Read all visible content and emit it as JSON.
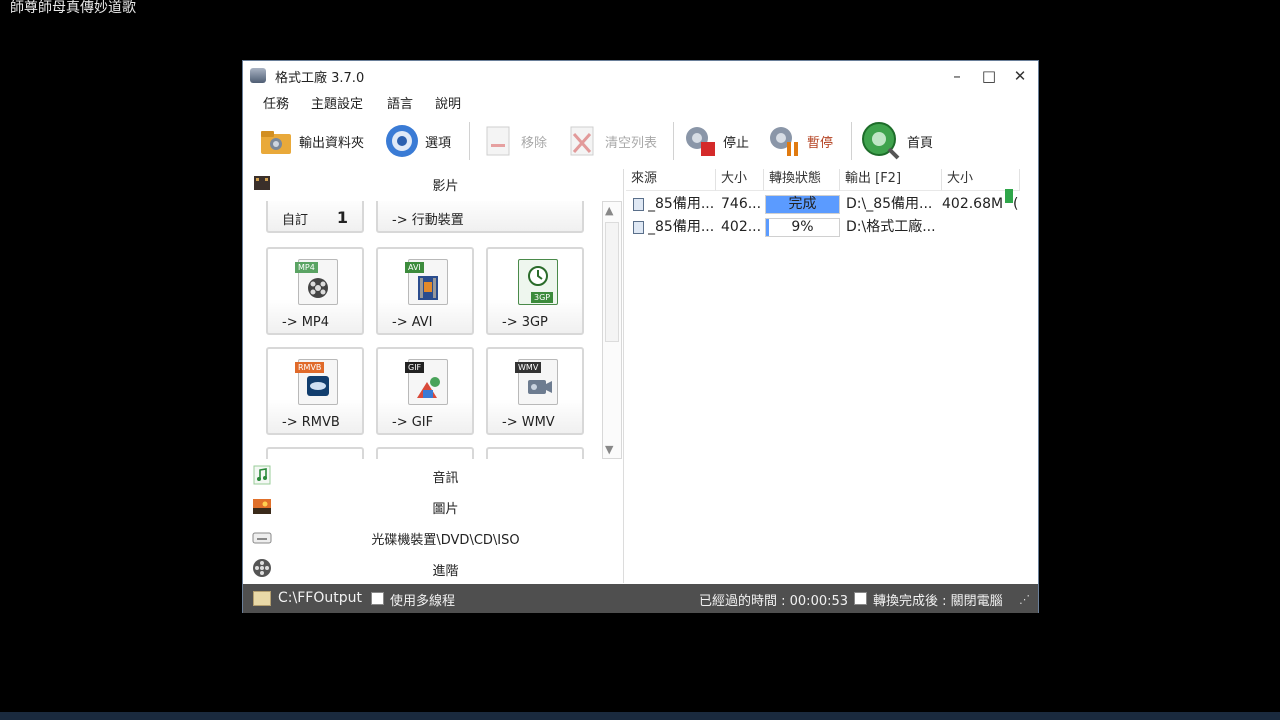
{
  "desktop": {
    "title": "師尊師母真傳妙道歌"
  },
  "window": {
    "title": "格式工廠 3.7.0",
    "controls": {
      "minimize": "–",
      "maximize": "□",
      "close": "✕"
    }
  },
  "menu": [
    "任務",
    "主題設定",
    "語言",
    "說明"
  ],
  "toolbar": {
    "output_folder": "輸出資料夾",
    "options": "選項",
    "remove": "移除",
    "clear_list": "清空列表",
    "stop": "停止",
    "pause": "暫停",
    "home": "首頁"
  },
  "categories": {
    "video": "影片",
    "audio": "音訊",
    "image": "圖片",
    "disc": "光碟機裝置\\DVD\\CD\\ISO",
    "advanced": "進階"
  },
  "tiles": {
    "custom": "自訂",
    "custom_badge": "1",
    "mobile": "-> 行動裝置",
    "mp4": "-> MP4",
    "avi": "-> AVI",
    "3gp": "-> 3GP",
    "rmvb": "-> RMVB",
    "gif": "-> GIF",
    "wmv": "-> WMV"
  },
  "file_tags": {
    "mp4": "MP4",
    "avi": "AVI",
    "3gp": "3GP",
    "rmvb": "RMVB",
    "gif": "GIF",
    "wmv": "WMV"
  },
  "table": {
    "headers": [
      "來源",
      "大小",
      "轉換狀態",
      "輸出 [F2]",
      "大小"
    ],
    "rows": [
      {
        "source": "_85備用...",
        "size": "746...",
        "status": "完成",
        "progress": 1.0,
        "output": "D:\\_85備用...",
        "out_size": "402.68M",
        "out_extra": "("
      },
      {
        "source": "_85備用...",
        "size": "402...",
        "status": "9%",
        "progress": 0.09,
        "output": "D:\\格式工廠...",
        "out_size": "",
        "out_extra": ""
      }
    ]
  },
  "statusbar": {
    "output_path": "C:\\FFOutput",
    "multithread": "使用多線程",
    "elapsed": "已經過的時間 : 00:00:53",
    "after_convert": "轉換完成後 : 關閉電腦"
  },
  "colors": {
    "progress": "#5b9bff",
    "status_bg": "#4f4f4f"
  }
}
